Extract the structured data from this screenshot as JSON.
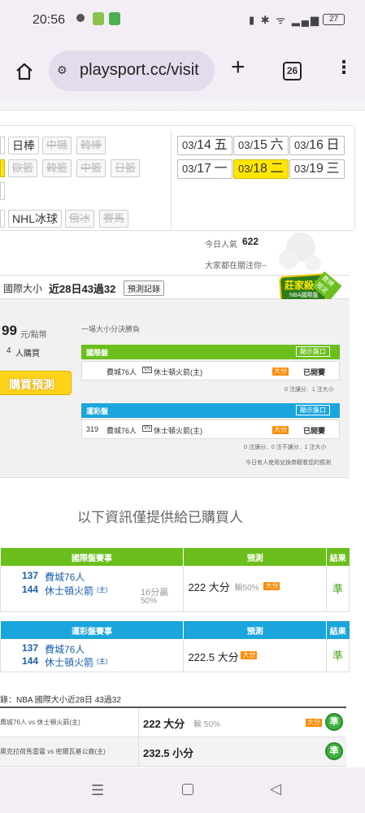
{
  "status": {
    "time": "20:56",
    "battery": "27"
  },
  "browser": {
    "url": "playsport.cc/visit",
    "tabs": "26"
  },
  "sports": {
    "row1": [
      "日棒",
      "中職",
      "韓棒"
    ],
    "row2": [
      "歐籃",
      "韓籃",
      "中籃",
      "日籃"
    ],
    "row4": [
      "NHL冰球",
      "俄冰",
      "賽馬"
    ]
  },
  "dates": [
    {
      "md": "03/",
      "d": "14",
      "w": "五"
    },
    {
      "md": "03/",
      "d": "15",
      "w": "六"
    },
    {
      "md": "03/",
      "d": "16",
      "w": "日"
    },
    {
      "md": "03/",
      "d": "17",
      "w": "一"
    },
    {
      "md": "03/",
      "d": "18",
      "w": "二"
    },
    {
      "md": "03/",
      "d": "19",
      "w": "三"
    }
  ],
  "popularity": {
    "label": "今日人氣",
    "value": "622",
    "sub": "大家都在關注你~"
  },
  "record": {
    "prefix": "國際大小",
    "text": "近28日43過32",
    "btn": "預測記錄"
  },
  "badge": {
    "title": "莊家殺手",
    "sub": "NBA國際盤",
    "ribbon": "賣牌限定"
  },
  "purchase": {
    "price": "99",
    "unit": "元/點幣",
    "buyers": "4",
    "buyers_unit": "人購買",
    "buy_btn": "購買預測"
  },
  "panel": {
    "title": "一場大小分決勝負",
    "intl": {
      "header": "國際盤",
      "show_btn": "顯示盤口",
      "match": "費城76人",
      "vs": "VS",
      "home": "休士頓火箭(主)",
      "tag": "大分",
      "status": "已開賽",
      "note": "0 注讓分．1 注大小"
    },
    "lottery": {
      "header": "運彩盤",
      "show_btn": "顯示盤口",
      "no": "319",
      "match": "費城76人",
      "vs": "VS",
      "home": "休士頓火箭(主)",
      "tag": "大分",
      "status": "已開賽",
      "note": "0 注讓分．0 注不讓分．1 注大小"
    },
    "foot": "今日有人使用兌換券觀看您的預測"
  },
  "info_notice": "以下資訊僅提供給已購買人",
  "t1": {
    "h1": "國際盤賽事",
    "h2": "預測",
    "h3": "結果",
    "n1": "137",
    "team1": "費城76人",
    "n2": "144",
    "team2": "休士頓火箭",
    "home": "(主)",
    "spread": "16分贏",
    "pct": "50%",
    "pred": "222 大分",
    "odds": "輸50%",
    "tag": "大分",
    "result": "準"
  },
  "t2": {
    "h1": "運彩盤賽事",
    "h2": "預測",
    "h3": "結果",
    "n1": "137",
    "team1": "費城76人",
    "n2": "144",
    "team2": "休士頓火箭",
    "home": "(主)",
    "pred": "222.5 大分",
    "tag": "大分",
    "result": "準"
  },
  "history": {
    "title": "錄：NBA 國際大小近28日 43過32",
    "rows": [
      {
        "match": "費城76人 vs 休士頓火箭(主)",
        "pred": "222 大分",
        "odds": "輸 50%",
        "tag": "大分",
        "result": "準"
      },
      {
        "match": "奧克拉荷馬雷霆 vs 密爾瓦基公鹿(主)",
        "pred": "232.5 小分",
        "odds": "",
        "tag": "",
        "result": "準"
      }
    ]
  }
}
